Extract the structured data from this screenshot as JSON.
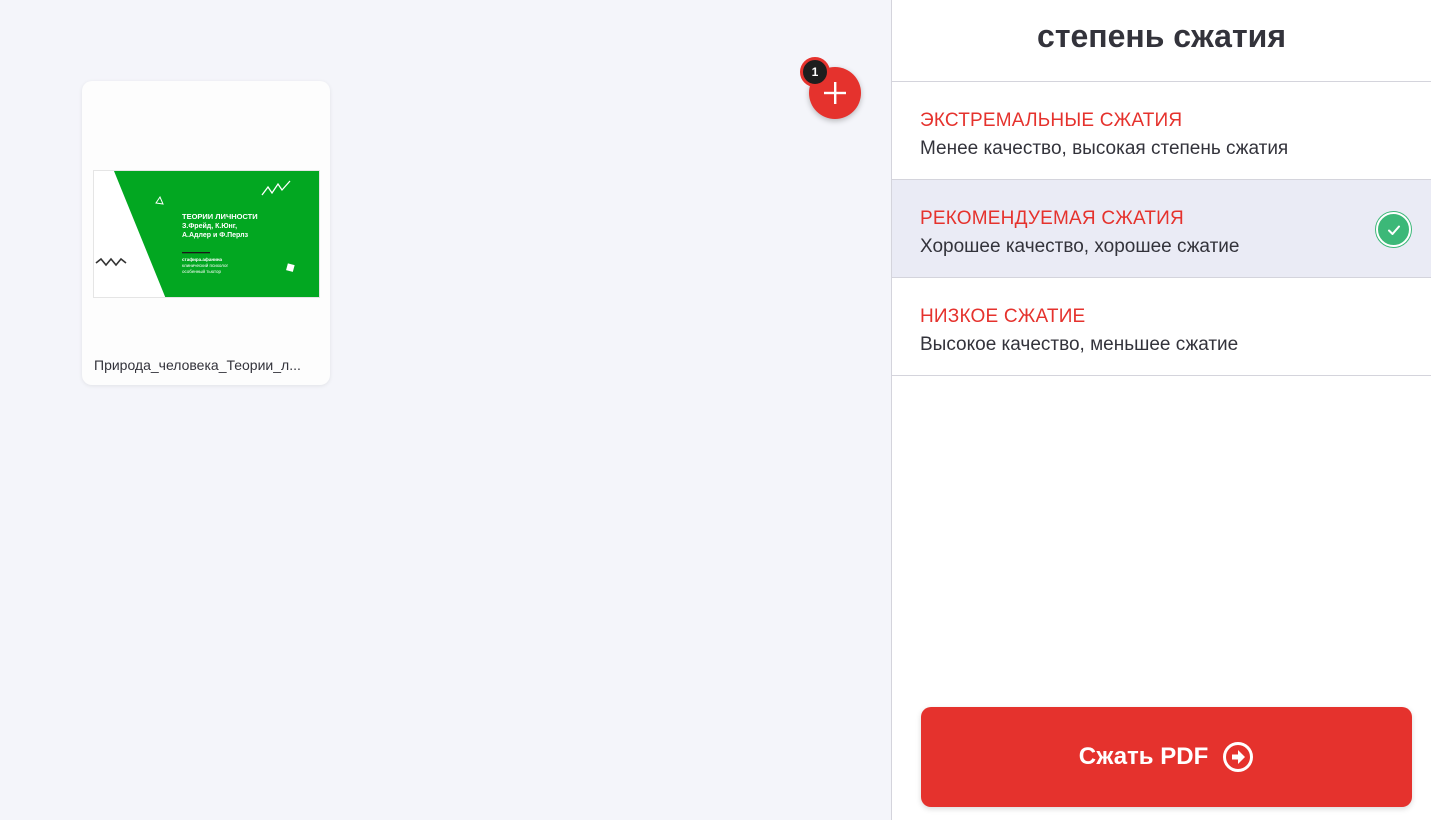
{
  "workspace": {
    "file": {
      "name": "Природа_человека_Теории_л...",
      "thumbnail": {
        "title": "ТЕОРИИ ЛИЧНОСТИ",
        "line2": "З.Фрейд, К.Юнг,",
        "line3": "А.Адлер и Ф.Перлз",
        "sub1": "стафира.афанина",
        "sub2": "клинический психолог",
        "sub3": "особенный тьютор",
        "accent_color": "#02a721"
      }
    },
    "file_count_badge": "1",
    "add_icon": "plus-icon"
  },
  "sidebar": {
    "title": "степень сжатия",
    "options": [
      {
        "title": "ЭКСТРЕМАЛЬНЫЕ СЖАТИЯ",
        "desc": "Менее качество, высокая степень сжатия",
        "selected": false
      },
      {
        "title": "РЕКОМЕНДУЕМАЯ СЖАТИЯ",
        "desc": "Хорошее качество, хорошее сжатие",
        "selected": true
      },
      {
        "title": "НИЗКОЕ СЖАТИЕ",
        "desc": "Высокое качество, меньшее сжатие",
        "selected": false
      }
    ],
    "submit_label": "Сжать PDF",
    "submit_icon": "arrow-right-circle-icon"
  },
  "colors": {
    "brand_red": "#e5322d",
    "check_green": "#3cb878",
    "selected_bg": "#eaebf5"
  }
}
